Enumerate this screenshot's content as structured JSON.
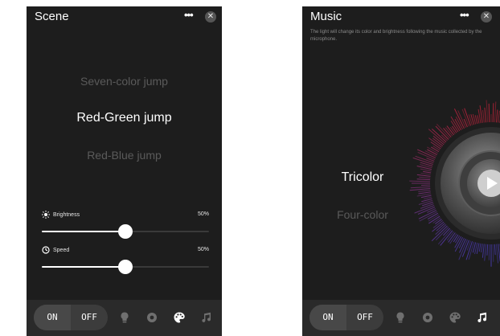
{
  "scene": {
    "title": "Scene",
    "more_label": "•••",
    "close_label": "✕",
    "modes": [
      "Seven-color jump",
      "Red-Green jump",
      "Red-Blue jump"
    ],
    "selected_mode": "Red-Green jump",
    "brightness": {
      "label": "Brightness",
      "value_text": "50%",
      "value": 0.5
    },
    "speed": {
      "label": "Speed",
      "value_text": "50%",
      "value": 0.5
    },
    "bottom": {
      "on_label": "ON",
      "off_label": "OFF",
      "active_tab": "scene"
    }
  },
  "music": {
    "title": "Music",
    "more_label": "•••",
    "close_label": "✕",
    "description": "The light will change its color and brightness following the music collected by the microphone.",
    "modes": [
      "Tricolor",
      "Four-color"
    ],
    "selected_mode": "Tricolor",
    "bottom": {
      "on_label": "ON",
      "off_label": "OFF",
      "active_tab": "music"
    }
  },
  "colors": {
    "background": "#1d1d1d",
    "bar": "#2a2a2a",
    "ring_start": "#c0223a",
    "ring_end": "#4a3bb5"
  }
}
